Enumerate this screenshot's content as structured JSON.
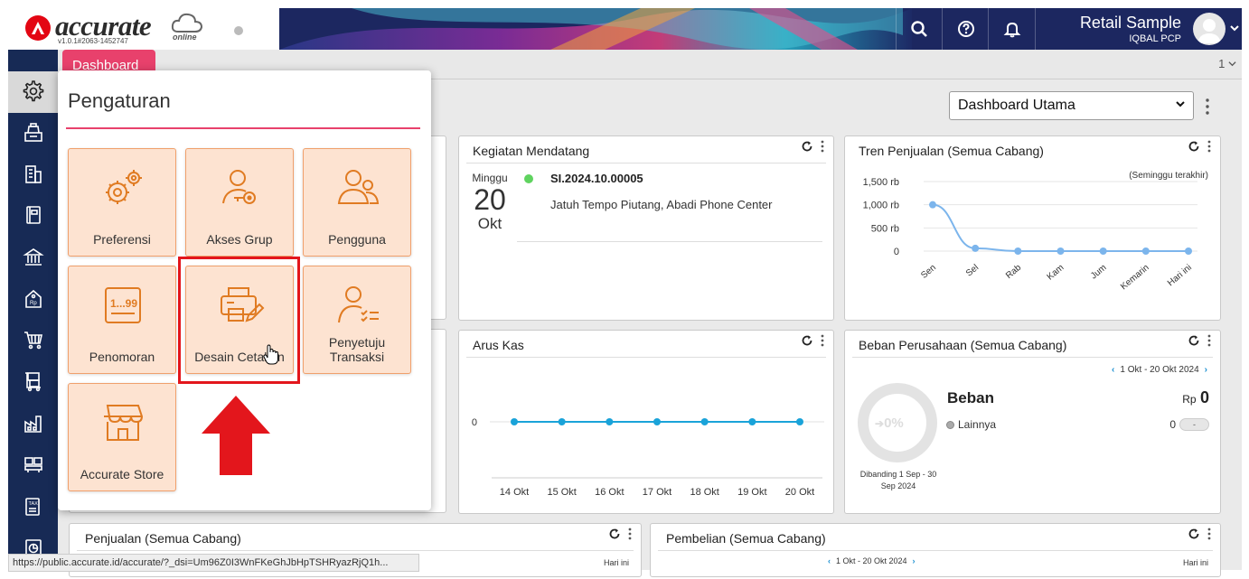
{
  "brand": {
    "name": "accurate",
    "version": "v1.0.1#2063-1452747",
    "suffix": "online"
  },
  "header": {
    "company": "Retail Sample",
    "user": "IQBAL PCP",
    "icons": [
      "search-icon",
      "help-icon",
      "bell-icon"
    ]
  },
  "tabs": {
    "active": "Dashboard",
    "count": "1"
  },
  "dashboard_select": "Dashboard Utama",
  "popup": {
    "title": "Pengaturan",
    "tiles": [
      {
        "label": "Preferensi",
        "icon": "gears-icon"
      },
      {
        "label": "Akses Grup",
        "icon": "user-key-icon"
      },
      {
        "label": "Pengguna",
        "icon": "users-icon"
      },
      {
        "label": "Penomoran",
        "icon": "numbering-icon"
      },
      {
        "label": "Desain Cetakan",
        "icon": "print-design-icon"
      },
      {
        "label": "Penyetuju Transaksi",
        "icon": "user-approve-icon"
      },
      {
        "label": "Accurate Store",
        "icon": "store-icon"
      }
    ]
  },
  "cards": {
    "kegiatan": {
      "title": "Kegiatan Mendatang",
      "day": "Minggu",
      "date": "20",
      "month": "Okt",
      "ref": "SI.2024.10.00005",
      "desc": "Jatuh Tempo Piutang, Abadi Phone Center"
    },
    "tren": {
      "title": "Tren Penjualan (Semua Cabang)",
      "note": "(Seminggu terakhir)"
    },
    "arus": {
      "title": "Arus Kas"
    },
    "beban": {
      "title": "Beban Perusahaan (Semua Cabang)",
      "range": "1 Okt - 20 Okt 2024",
      "percent": "0%",
      "heading": "Beban",
      "currency": "Rp",
      "total": "0",
      "item_label": "Lainnya",
      "item_value": "0",
      "item_badge": "-",
      "compare": "Dibanding 1 Sep - 30 Sep 2024"
    },
    "penjualan": {
      "title": "Penjualan (Semua Cabang)",
      "period": "Hari ini"
    },
    "pembelian": {
      "title": "Pembelian (Semua Cabang)",
      "range": "1 Okt - 20 Okt 2024",
      "period": "Hari ini"
    }
  },
  "chart_data": [
    {
      "type": "line",
      "categories": [
        "Sen",
        "Sel",
        "Rab",
        "Kam",
        "Jum",
        "Kemarin",
        "Hari ini"
      ],
      "yticks": [
        "0",
        "500 rb",
        "1,000 rb",
        "1,500 rb"
      ],
      "ylim": [
        0,
        1500
      ],
      "series": [
        {
          "values": [
            1000,
            60,
            0,
            0,
            0,
            0,
            0
          ]
        }
      ],
      "color": "#7cb5ec"
    },
    {
      "type": "line",
      "categories": [
        "14 Okt",
        "15 Okt",
        "16 Okt",
        "17 Okt",
        "18 Okt",
        "19 Okt",
        "20 Okt"
      ],
      "yticks": [
        "0"
      ],
      "series": [
        {
          "values": [
            0,
            0,
            0,
            0,
            0,
            0,
            0
          ]
        }
      ],
      "color": "#1aa3d9"
    }
  ],
  "statusbar": "https://public.accurate.id/accurate/?_dsi=Um96Z0I3WnFKeGhJbHpTSHRyazRjQ1h..."
}
